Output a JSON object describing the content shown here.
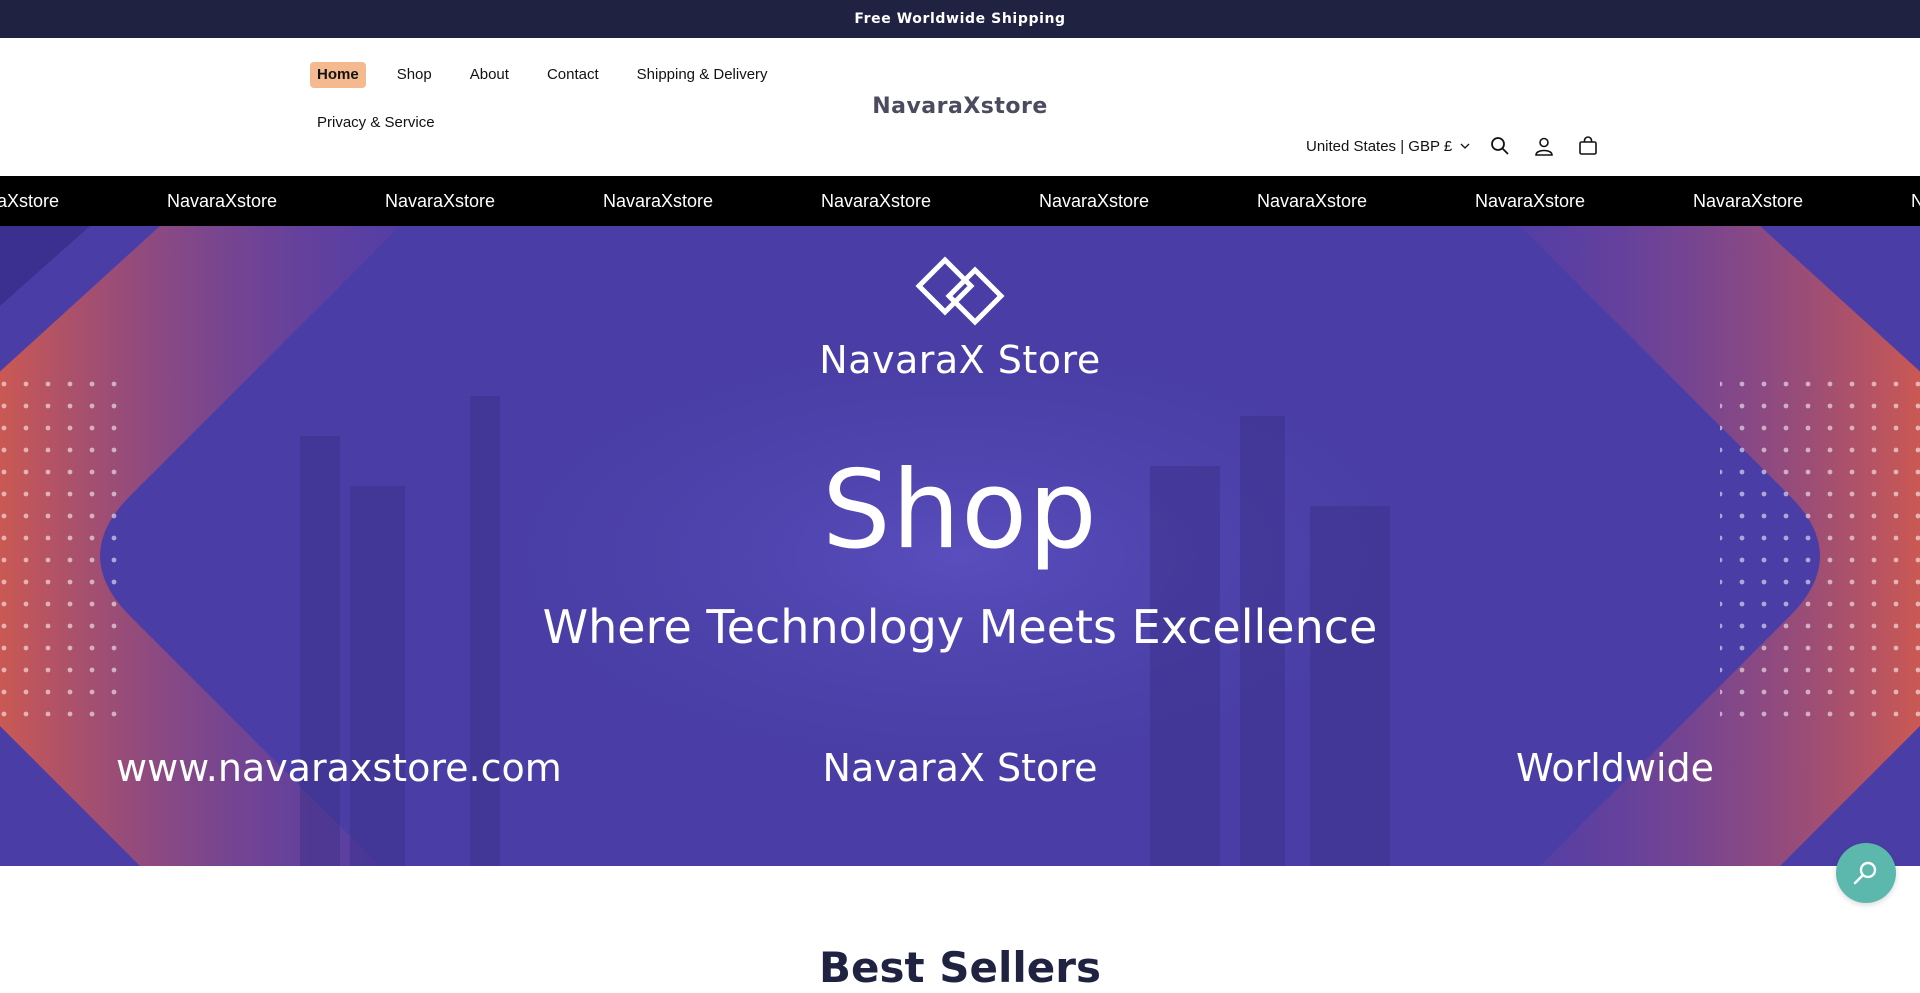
{
  "announcement": {
    "text": "Free Worldwide Shipping"
  },
  "nav": {
    "items": [
      {
        "label": "Home",
        "active": true
      },
      {
        "label": "Shop"
      },
      {
        "label": "About"
      },
      {
        "label": "Contact"
      },
      {
        "label": "Shipping & Delivery"
      },
      {
        "label": "Privacy & Service"
      }
    ]
  },
  "header": {
    "logo": "NavaraXstore",
    "currency": "United States | GBP £",
    "icons": [
      "search-icon",
      "account-icon",
      "cart-icon"
    ]
  },
  "marquee": {
    "items": [
      "NavaraXstore",
      "NavaraXstore",
      "NavaraXstore",
      "NavaraXstore",
      "NavaraXstore",
      "NavaraXstore",
      "NavaraXstore",
      "NavaraXstore",
      "NavaraXstore",
      "NavaraXstore"
    ]
  },
  "hero": {
    "brand_name": "NavaraX Store",
    "headline": "Shop",
    "tagline": "Where Technology Meets Excellence",
    "footer_url": "www.navaraxstore.com",
    "footer_brand": "NavaraX Store",
    "footer_region": "Worldwide"
  },
  "section": {
    "title": "Best Sellers"
  },
  "colors": {
    "announcement_bg": "#1f2240",
    "active_nav_bg": "#f4b98f",
    "marquee_bg": "#000000",
    "hero_bg": "#4b3fa8",
    "hero_accent": "#e8603c",
    "fab_bg": "#5cb8ad"
  }
}
